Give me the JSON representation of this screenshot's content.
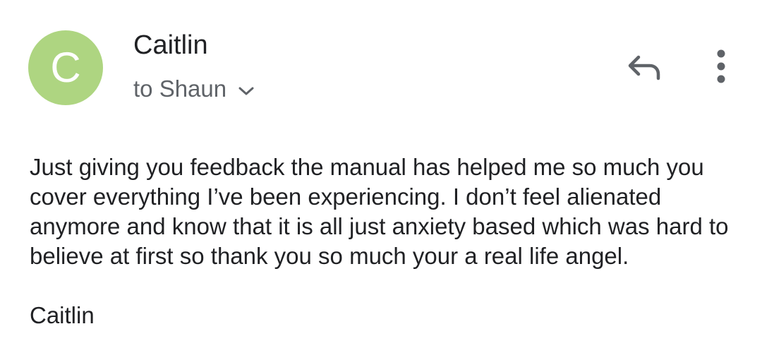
{
  "avatar": {
    "initial": "C",
    "color": "#aed581"
  },
  "header": {
    "sender": "Caitlin",
    "recipient": "to Shaun",
    "recipient_toggle_icon": "chevron-down-icon",
    "reply_icon": "reply-icon",
    "more_icon": "more-vertical-icon"
  },
  "message": {
    "body": "Just giving you feedback the manual has helped me so much you cover everything I’ve been experiencing. I don’t feel alienated anymore and know that it is all just anxiety based which was hard to believe at first so thank you so much your a real life angel.",
    "signature": "Caitlin"
  }
}
